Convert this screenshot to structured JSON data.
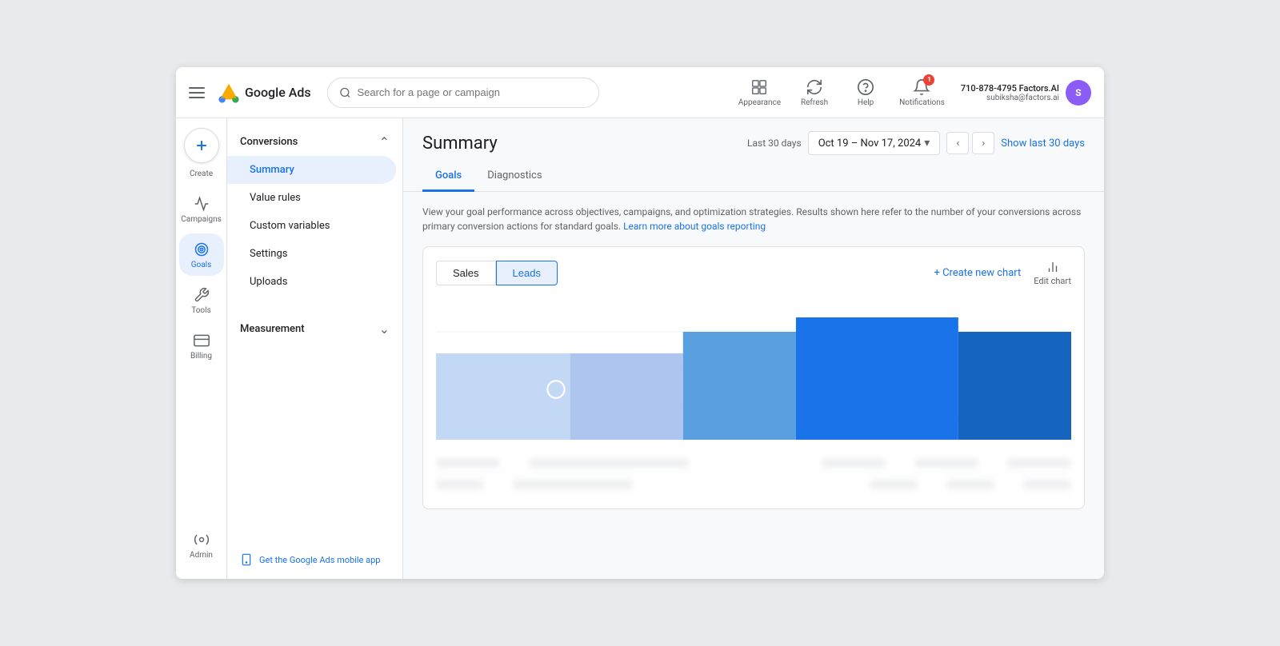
{
  "topbar": {
    "menu_label": "Menu",
    "logo_text": "Google Ads",
    "search_placeholder": "Search for a page or campaign",
    "actions": [
      {
        "id": "appearance",
        "label": "Appearance",
        "icon": "appearance-icon"
      },
      {
        "id": "refresh",
        "label": "Refresh",
        "icon": "refresh-icon"
      },
      {
        "id": "help",
        "label": "Help",
        "icon": "help-icon"
      },
      {
        "id": "notifications",
        "label": "Notifications",
        "icon": "bell-icon",
        "badge": "1"
      }
    ],
    "user": {
      "phone": "710-878-4795 Factors.AI",
      "email": "subiksha@factors.ai",
      "initials": "S"
    }
  },
  "sidebar_narrow": {
    "create_label": "Create",
    "nav_items": [
      {
        "id": "campaigns",
        "label": "Campaigns",
        "icon": "campaigns-icon",
        "active": false
      },
      {
        "id": "goals",
        "label": "Goals",
        "icon": "goals-icon",
        "active": true
      },
      {
        "id": "tools",
        "label": "Tools",
        "icon": "tools-icon",
        "active": false
      },
      {
        "id": "billing",
        "label": "Billing",
        "icon": "billing-icon",
        "active": false
      },
      {
        "id": "admin",
        "label": "Admin",
        "icon": "admin-icon",
        "active": false
      }
    ]
  },
  "sidebar_wide": {
    "section_header": "Conversions",
    "nav_items": [
      {
        "id": "summary",
        "label": "Summary",
        "active": true
      },
      {
        "id": "value-rules",
        "label": "Value rules",
        "active": false
      },
      {
        "id": "custom-variables",
        "label": "Custom variables",
        "active": false
      },
      {
        "id": "settings",
        "label": "Settings",
        "active": false
      },
      {
        "id": "uploads",
        "label": "Uploads",
        "active": false
      }
    ],
    "sub_section": "Measurement",
    "footer_text": "Get the Google Ads mobile app"
  },
  "content": {
    "title": "Summary",
    "date_label": "Last 30 days",
    "date_range": "Oct 19 – Nov 17, 2024",
    "show_last_label": "Show last 30 days",
    "tabs": [
      {
        "id": "goals",
        "label": "Goals",
        "active": true
      },
      {
        "id": "diagnostics",
        "label": "Diagnostics",
        "active": false
      }
    ],
    "description": "View your goal performance across objectives, campaigns, and optimization strategies. Results shown here refer to the number of your conversions across primary conversion actions for standard goals.",
    "learn_more_text": "Learn more about goals reporting",
    "chart": {
      "toggle_options": [
        {
          "id": "sales",
          "label": "Sales",
          "active": false
        },
        {
          "id": "leads",
          "label": "Leads",
          "active": true
        }
      ],
      "create_chart_label": "+ Create new chart",
      "edit_chart_label": "Edit chart",
      "bar_data": [
        {
          "value": 60,
          "color": "#aec6ef",
          "dark": false
        },
        {
          "value": 60,
          "color": "#aec6ef",
          "dark": false
        },
        {
          "value": 80,
          "color": "#5a9fe0",
          "dark": false
        },
        {
          "value": 100,
          "color": "#1a73e8",
          "dark": true
        },
        {
          "value": 100,
          "color": "#1a73e8",
          "dark": true
        },
        {
          "value": 80,
          "color": "#1a73e8",
          "dark": true
        }
      ]
    }
  }
}
